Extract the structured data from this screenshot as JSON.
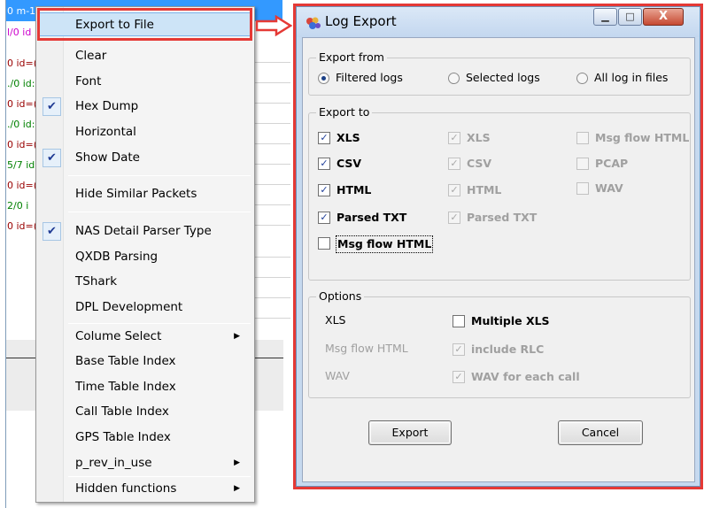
{
  "background_list": {
    "rows": [
      {
        "text": "0 m-1",
        "color": "#ffffff"
      },
      {
        "text": "l/0 id",
        "color": "#cc00cc"
      },
      {
        "text": "0 id=(",
        "color": "#990000"
      },
      {
        "text": "./0 id:",
        "color": "#008000"
      },
      {
        "text": "0 id=(",
        "color": "#990000"
      },
      {
        "text": "./0 id:",
        "color": "#008000"
      },
      {
        "text": "0 id=(",
        "color": "#990000"
      },
      {
        "text": "5/7 id",
        "color": "#008000"
      },
      {
        "text": "0 id=(",
        "color": "#990000"
      },
      {
        "text": "2/0 i",
        "color": "#008000"
      },
      {
        "text": "0 id=(",
        "color": "#990000"
      }
    ]
  },
  "context_menu": {
    "items": [
      {
        "label": "Export to File",
        "checked": false,
        "submenu": false,
        "selected": true
      },
      {
        "label": "Clear",
        "checked": false,
        "submenu": false
      },
      {
        "label": "Font",
        "checked": false,
        "submenu": false
      },
      {
        "label": "Hex Dump",
        "checked": true,
        "submenu": false
      },
      {
        "label": "Horizontal",
        "checked": false,
        "submenu": false
      },
      {
        "label": "Show Date",
        "checked": true,
        "submenu": false
      },
      {
        "label": "Hide Similar Packets",
        "checked": false,
        "submenu": false
      },
      {
        "label": "NAS Detail Parser Type",
        "checked": true,
        "submenu": false
      },
      {
        "label": "QXDB Parsing",
        "checked": false,
        "submenu": false
      },
      {
        "label": "TShark",
        "checked": false,
        "submenu": false
      },
      {
        "label": "DPL Development",
        "checked": false,
        "submenu": false
      },
      {
        "label": "Colume Select",
        "checked": false,
        "submenu": true
      },
      {
        "label": "Base Table Index",
        "checked": false,
        "submenu": false
      },
      {
        "label": "Time Table Index",
        "checked": false,
        "submenu": false
      },
      {
        "label": "Call Table Index",
        "checked": false,
        "submenu": false
      },
      {
        "label": "GPS Table Index",
        "checked": false,
        "submenu": false
      },
      {
        "label": "p_rev_in_use",
        "checked": false,
        "submenu": true
      },
      {
        "label": "Hidden functions",
        "checked": false,
        "submenu": true
      }
    ],
    "check_glyph": "✔",
    "submenu_glyph": "▶"
  },
  "dialog": {
    "title": "Log Export",
    "window_buttons": {
      "minimize": "▁",
      "maximize": "□",
      "close": "X"
    },
    "export_from": {
      "label": "Export from",
      "options": [
        {
          "label": "Filtered logs",
          "selected": true
        },
        {
          "label": "Selected logs",
          "selected": false
        },
        {
          "label": "All log in files",
          "selected": false
        }
      ]
    },
    "export_to": {
      "label": "Export to",
      "col1": [
        {
          "label": "XLS",
          "checked": true,
          "disabled": false
        },
        {
          "label": "CSV",
          "checked": true,
          "disabled": false
        },
        {
          "label": "HTML",
          "checked": true,
          "disabled": false
        },
        {
          "label": "Parsed TXT",
          "checked": true,
          "disabled": false
        },
        {
          "label": "Msg flow HTML",
          "checked": false,
          "disabled": false
        }
      ],
      "col2": [
        {
          "label": "XLS",
          "checked": true,
          "disabled": true
        },
        {
          "label": "CSV",
          "checked": true,
          "disabled": true
        },
        {
          "label": "HTML",
          "checked": true,
          "disabled": true
        },
        {
          "label": "Parsed TXT",
          "checked": true,
          "disabled": true
        }
      ],
      "col3": [
        {
          "label": "Msg flow HTML",
          "checked": false,
          "disabled": true
        },
        {
          "label": "PCAP",
          "checked": false,
          "disabled": true
        },
        {
          "label": "WAV",
          "checked": false,
          "disabled": true
        }
      ]
    },
    "options": {
      "label": "Options",
      "rows": [
        {
          "name": "XLS",
          "name_disabled": false,
          "check_label": "Multiple XLS",
          "checked": false,
          "disabled": false
        },
        {
          "name": "Msg flow HTML",
          "name_disabled": true,
          "check_label": "include RLC",
          "checked": true,
          "disabled": true
        },
        {
          "name": "WAV",
          "name_disabled": true,
          "check_label": "WAV for each call",
          "checked": true,
          "disabled": true
        }
      ]
    },
    "buttons": {
      "export": "Export",
      "cancel": "Cancel"
    },
    "check_glyph": "✓"
  },
  "colors": {
    "highlight_red": "#e53935",
    "menu_selection": "#cde4f7",
    "list_selection": "#3399ff"
  }
}
